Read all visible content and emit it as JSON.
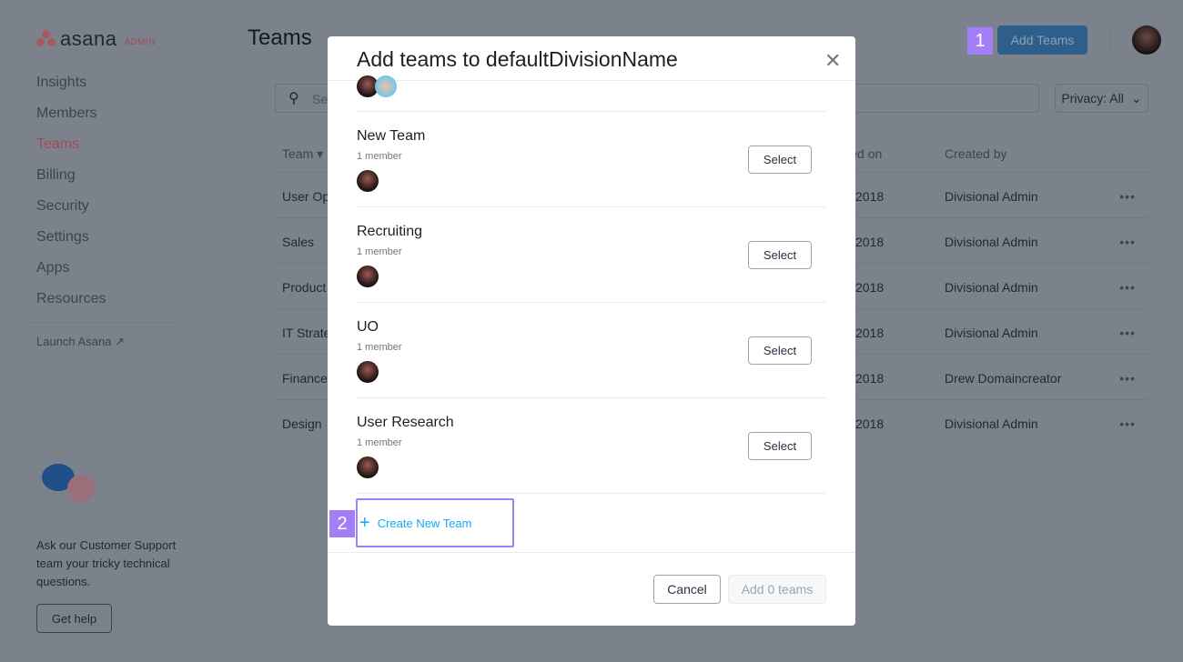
{
  "app": {
    "logo": "asana",
    "logo_badge": "ADMIN",
    "page_title": "Teams",
    "add_teams": "Add Teams",
    "privacy": "Privacy: All",
    "search_placeholder": "Search"
  },
  "sidebar": {
    "items": [
      {
        "label": "Insights"
      },
      {
        "label": "Members"
      },
      {
        "label": "Teams",
        "active": true
      },
      {
        "label": "Billing"
      },
      {
        "label": "Security"
      },
      {
        "label": "Settings"
      },
      {
        "label": "Apps"
      },
      {
        "label": "Resources"
      }
    ],
    "launch": "Launch Asana",
    "support_text": "Ask our Customer Support team your tricky technical questions.",
    "get_help": "Get help"
  },
  "table": {
    "headers": {
      "team": "Team",
      "created_on": "Created on",
      "created_by": "Created by"
    },
    "rows": [
      {
        "team": "User Op",
        "date": "2018",
        "by": "Divisional Admin"
      },
      {
        "team": "Sales",
        "date": "2018",
        "by": "Divisional Admin"
      },
      {
        "team": "Product",
        "date": "2018",
        "by": "Divisional Admin"
      },
      {
        "team": "IT Strate",
        "date": "2018",
        "by": "Divisional Admin"
      },
      {
        "team": "Finance",
        "date": "2018",
        "by": "Drew Domaincreator"
      },
      {
        "team": "Design",
        "date": "2018",
        "by": "Divisional Admin"
      }
    ]
  },
  "modal": {
    "title": "Add teams to defaultDivisionName",
    "teams": [
      {
        "name": "New Team",
        "members": "1 member",
        "select": "Select"
      },
      {
        "name": "Recruiting",
        "members": "1 member",
        "select": "Select"
      },
      {
        "name": "UO",
        "members": "1 member",
        "select": "Select"
      },
      {
        "name": "User Research",
        "members": "1 member",
        "select": "Select"
      }
    ],
    "create": "Create New Team",
    "cancel": "Cancel",
    "add": "Add 0 teams"
  },
  "annotations": {
    "badge1": "1",
    "badge2": "2",
    "color": "#a27ef7"
  }
}
